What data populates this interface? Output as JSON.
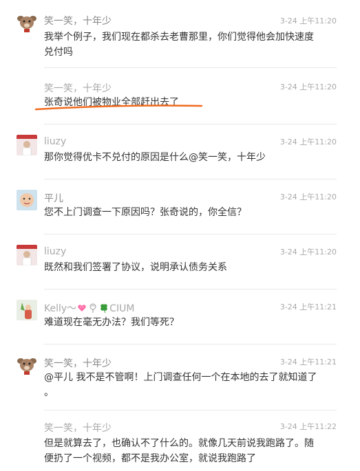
{
  "messages": [
    {
      "name": "笑一笑，十年少",
      "time": "3-24 上午11:20",
      "text_lines": [
        "我举个例子，我们现在都杀去老曹那里，你们觉得他会加快速度",
        "兑付吗"
      ]
    },
    {
      "name": "笑一笑，十年少",
      "time": "3-24 上午11:20",
      "text_lines": [
        "张奇说他们被物业全部赶出去了"
      ]
    },
    {
      "name": "liuzy",
      "time": "3-24 上午11:20",
      "text_lines": [
        "那你觉得优卡不兑付的原因是什么@笑一笑，十年少"
      ]
    },
    {
      "name": "平儿",
      "time": "3-24 上午11:20",
      "text_lines": [
        "您不上门调查一下原因吗？张奇说的，你全信？"
      ]
    },
    {
      "name": "liuzy",
      "time": "3-24 上午11:20",
      "text_lines": [
        "既然和我们签署了协议，说明承认债务关系"
      ]
    },
    {
      "name_prefix": "Kelly～",
      "name_suffix": "CIUM",
      "time": "3-24 上午11:21",
      "text_lines": [
        "难道现在毫无办法？我们等死？"
      ]
    },
    {
      "name": "笑一笑，十年少",
      "time": "3-24 上午11:21",
      "text_lines": [
        "@平儿 我不是不管啊！上门调查任何一个在本地的去了就知道了",
        "。"
      ]
    },
    {
      "name": "笑一笑，十年少",
      "time": "3-24 上午11:22",
      "text_lines": [
        "但是就算去了，也确认不了什么的。就像几天前说我跑路了。随",
        "便扔了一个视频，都不是我办公室，就说我跑路了"
      ]
    }
  ],
  "icons": [
    "pig-avatar",
    "liuzy-avatar",
    "baby-avatar",
    "kelly-avatar",
    "heart-emoji",
    "lollipop-emoji",
    "clover-emoji"
  ],
  "colors": {
    "underline": "#f06a1e",
    "meta": "#a8a8a8",
    "text": "#333333"
  }
}
